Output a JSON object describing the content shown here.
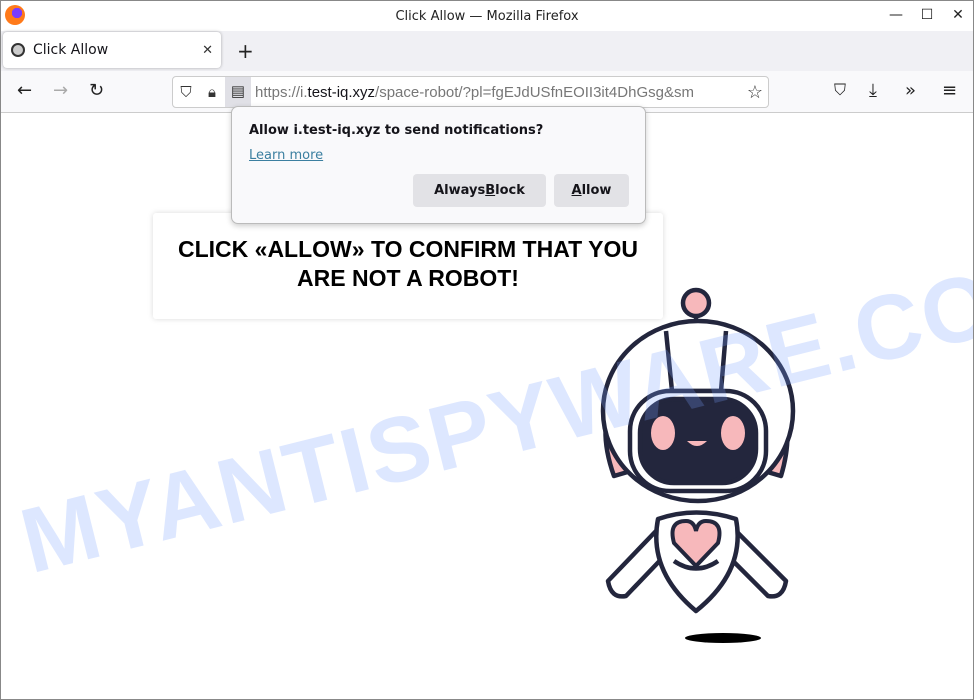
{
  "window": {
    "title": "Click Allow — Mozilla Firefox",
    "minimize": "—",
    "maximize": "☐",
    "close": "✕"
  },
  "tab": {
    "label": "Click Allow",
    "close": "✕",
    "new_tab": "+"
  },
  "nav": {
    "back": "←",
    "forward": "→",
    "reload": "↻",
    "url_scheme": "https://i.",
    "url_host": "test-iq.xyz",
    "url_rest": "/space-robot/?pl=fgEJdUSfnEOII3it4DhGsg&sm",
    "bookmark": "☆",
    "pocket": "⛉",
    "downloads": "⤓",
    "more_tools": "»",
    "menu": "≡"
  },
  "popup": {
    "question": "Allow i.test-iq.xyz to send notifications?",
    "learn_more": "Learn more",
    "block_pre": "Always ",
    "block_key": "B",
    "block_post": "lock",
    "allow_key": "A",
    "allow_post": "llow"
  },
  "page": {
    "line1": "CLICK «ALLOW» TO CONFIRM THAT YOU",
    "line2": "ARE NOT A ROBOT!",
    "watermark": "MYANTISPYWARE.COM"
  },
  "colors": {
    "robot_outline": "#23263d",
    "robot_pink": "#f7b8bb",
    "watermark": "#a0bfff"
  }
}
